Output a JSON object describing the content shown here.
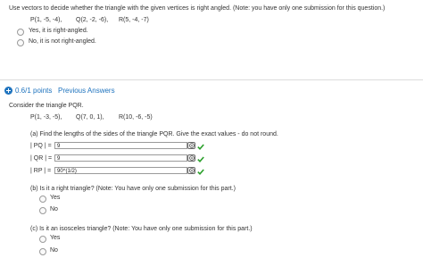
{
  "q1": {
    "prompt": "Use vectors to decide whether the triangle with the given vertices is right angled. (Note: you have only one submission for this question.)",
    "vertices": [
      "P(1, -5, -4),",
      "Q(2, -2, -6),",
      "R(5, -4, -7)"
    ],
    "options": [
      "Yes, it is right-angled.",
      "No, it is not right-angled."
    ]
  },
  "q2": {
    "points": "0.6/1 points",
    "previous_answers": "Previous Answers",
    "intro": "Consider the triangle PQR.",
    "vertices": [
      "P(1, -3, -5),",
      "Q(7, 0, 1),",
      "R(10, -6, -5)"
    ],
    "part_a": {
      "prompt": "(a) Find the lengths of the sides of the triangle PQR. Give the exact values - do not round.",
      "rows": [
        {
          "label": "| PQ | =",
          "value": "9"
        },
        {
          "label": "| QR | =",
          "value": "9"
        },
        {
          "label": "| RP | =",
          "value": "90^(1/2)"
        }
      ]
    },
    "part_b": {
      "prompt": "(b) Is it a right triangle? (Note: You have only one submission for this part.)",
      "options": [
        "Yes",
        "No"
      ]
    },
    "part_c": {
      "prompt": "(c) Is it an isosceles triangle? (Note: You have only one submission for this part.)",
      "options": [
        "Yes",
        "No"
      ]
    }
  },
  "colors": {
    "accent": "#1e73be",
    "check": "#2ca02c"
  }
}
